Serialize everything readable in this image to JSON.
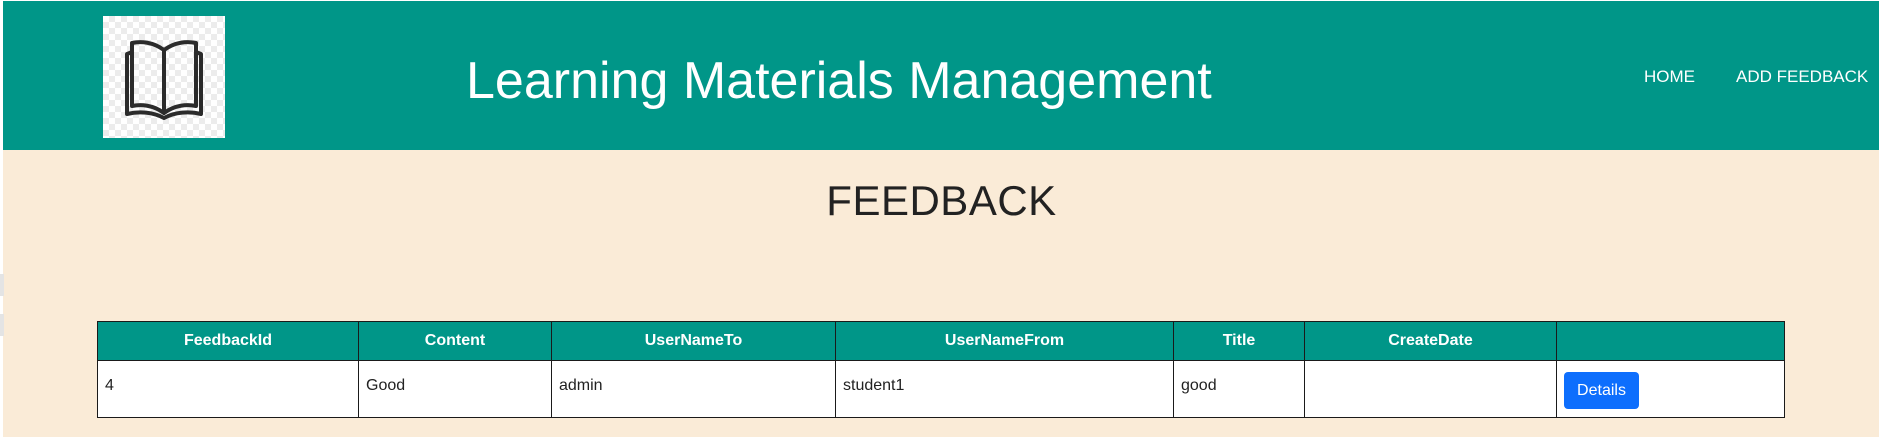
{
  "header": {
    "logo_icon": "open-book-icon",
    "title": "Learning Materials Management",
    "nav": [
      {
        "label": "HOME"
      },
      {
        "label": "ADD FEEDBACK"
      }
    ],
    "background_color": "#009688"
  },
  "page": {
    "heading": "FEEDBACK",
    "background_color": "#faebd7"
  },
  "table": {
    "columns": [
      "FeedbackId",
      "Content",
      "UserNameTo",
      "UserNameFrom",
      "Title",
      "CreateDate",
      ""
    ],
    "rows": [
      {
        "feedback_id": "4",
        "content": "Good",
        "user_name_to": "admin",
        "user_name_from": "student1",
        "title": "good",
        "create_date": "",
        "action_label": "Details"
      }
    ],
    "action_button_color": "#0d6efd"
  }
}
